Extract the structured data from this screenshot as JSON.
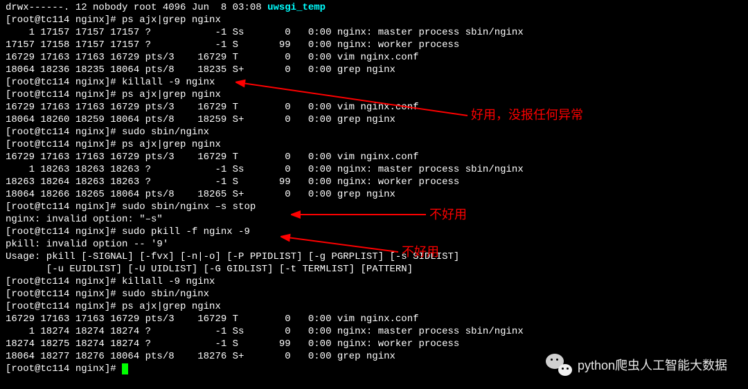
{
  "top_line_partial": "drwx------. 12 nobody root 4096 Jun  8 03:08 ",
  "top_line_teal": "uwsgi_temp",
  "prompt": "[root@tc114 nginx]# ",
  "commands": {
    "ps_grep": "ps ajx|grep nginx",
    "killall": "killall -9 nginx",
    "sudo_sbin": "sudo sbin/nginx",
    "sudo_stop": "sudo sbin/nginx –s stop",
    "sudo_pkill": "sudo pkill -f nginx -9"
  },
  "ps_output_1": [
    "    1 17157 17157 17157 ?           -1 Ss       0   0:00 nginx: master process sbin/nginx",
    "17157 17158 17157 17157 ?           -1 S       99   0:00 nginx: worker process",
    "16729 17163 17163 16729 pts/3    16729 T        0   0:00 vim nginx.conf",
    "18064 18236 18235 18064 pts/8    18235 S+       0   0:00 grep nginx"
  ],
  "ps_output_2": [
    "16729 17163 17163 16729 pts/3    16729 T        0   0:00 vim nginx.conf",
    "18064 18260 18259 18064 pts/8    18259 S+       0   0:00 grep nginx"
  ],
  "ps_output_3": [
    "16729 17163 17163 16729 pts/3    16729 T        0   0:00 vim nginx.conf",
    "    1 18263 18263 18263 ?           -1 Ss       0   0:00 nginx: master process sbin/nginx",
    "18263 18264 18263 18263 ?           -1 S       99   0:00 nginx: worker process",
    "18064 18266 18265 18064 pts/8    18265 S+       0   0:00 grep nginx"
  ],
  "nginx_error": "nginx: invalid option: \"–s\"",
  "pkill_error": "pkill: invalid option -- '9'",
  "pkill_usage_1": "Usage: pkill [-SIGNAL] [-fvx] [-n|-o] [-P PPIDLIST] [-g PGRPLIST] [-s SIDLIST]",
  "pkill_usage_2": "       [-u EUIDLIST] [-U UIDLIST] [-G GIDLIST] [-t TERMLIST] [PATTERN]",
  "ps_output_4": [
    "16729 17163 17163 16729 pts/3    16729 T        0   0:00 vim nginx.conf",
    "    1 18274 18274 18274 ?           -1 Ss       0   0:00 nginx: master process sbin/nginx",
    "18274 18275 18274 18274 ?           -1 S       99   0:00 nginx: worker process",
    "18064 18277 18276 18064 pts/8    18276 S+       0   0:00 grep nginx"
  ],
  "annotations": {
    "good": "好用，没报任何异常",
    "bad1": "不好用",
    "bad2": "不好用"
  },
  "watermark": "python爬虫人工智能大数据"
}
